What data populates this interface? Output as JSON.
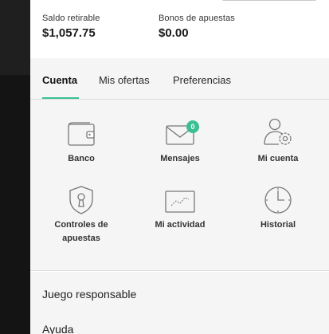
{
  "balances": [
    {
      "label": "Saldo retirable",
      "value": "$1,057.75"
    },
    {
      "label": "Bonos de apuestas",
      "value": "$0.00"
    }
  ],
  "tabs": [
    {
      "label": "Cuenta",
      "active": true
    },
    {
      "label": "Mis ofertas",
      "active": false
    },
    {
      "label": "Preferencias",
      "active": false
    }
  ],
  "tiles": [
    {
      "label": "Banco",
      "icon": "wallet-icon"
    },
    {
      "label": "Mensajes",
      "icon": "envelope-icon",
      "badge": "0"
    },
    {
      "label": "Mi cuenta",
      "icon": "user-gear-icon"
    },
    {
      "label": "Controles de apuestas",
      "icon": "shield-lock-icon"
    },
    {
      "label": "Mi actividad",
      "icon": "activity-chart-icon"
    },
    {
      "label": "Historial",
      "icon": "clock-icon"
    }
  ],
  "menu": [
    {
      "label": "Juego responsable"
    },
    {
      "label": "Ayuda"
    }
  ],
  "colors": {
    "accent": "#3bbf94",
    "panel_bg": "#f5f5f5",
    "backdrop": "#141414"
  }
}
